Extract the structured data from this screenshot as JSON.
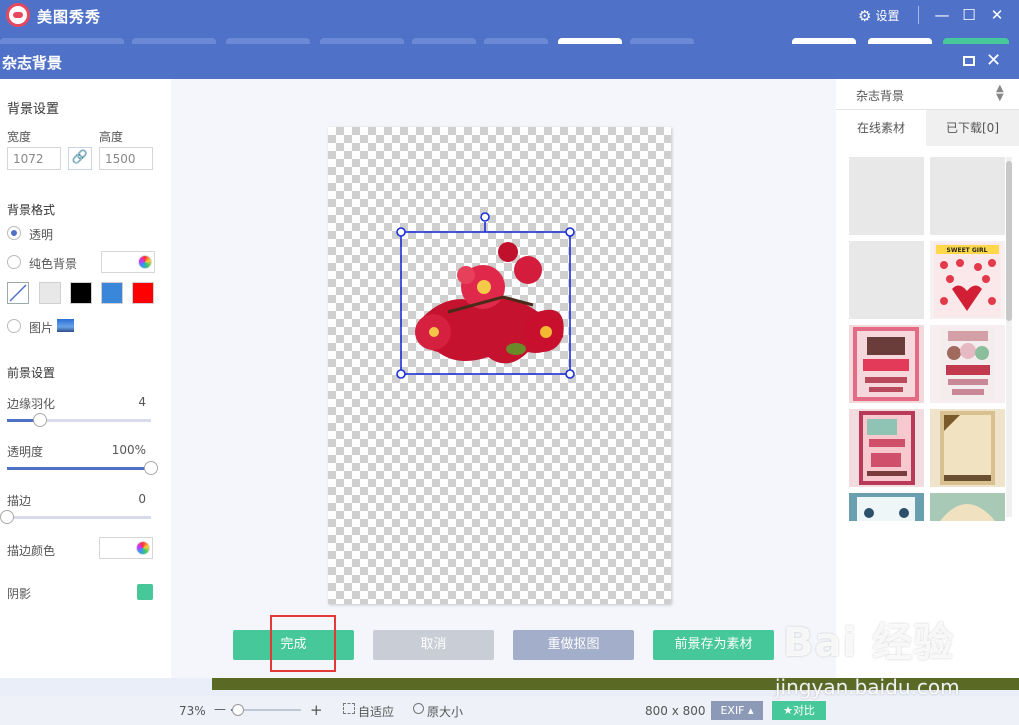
{
  "app": {
    "title": "美图秀秀",
    "settings_label": "设置",
    "minimize_glyph": "—",
    "maximize_glyph": "☐",
    "close_glyph": "✕",
    "gear_glyph": "⚙"
  },
  "dialog": {
    "title": "杂志背景",
    "close_glyph": "✕"
  },
  "left": {
    "bg_settings": "背景设置",
    "width_label": "宽度",
    "height_label": "高度",
    "width_value": "1072",
    "height_value": "1500",
    "link_glyph": "🔗",
    "bg_format": "背景格式",
    "opt_transparent": "透明",
    "opt_solid": "纯色背景",
    "opt_image": "图片",
    "swatch_colors": [
      "#e8e8e8",
      "#000000",
      "#3a86d9",
      "#ff0000"
    ],
    "fg_settings": "前景设置",
    "feather_label": "边缘羽化",
    "feather_value": "4",
    "feather_level": 0.23,
    "opacity_label": "透明度",
    "opacity_value": "100%",
    "opacity_level": 1.0,
    "stroke_label": "描边",
    "stroke_value": "0",
    "stroke_level": 0.0,
    "stroke_color_label": "描边颜色",
    "shadow_label": "阴影"
  },
  "actions": {
    "done": "完成",
    "cancel": "取消",
    "redo_cutout": "重做抠图",
    "save_fg": "前景存为素材"
  },
  "right": {
    "category": "杂志背景",
    "tab_online": "在线素材",
    "tab_downloaded": "已下载[0]",
    "sweet_girl": "SWEET GIRL"
  },
  "status": {
    "zoom": "73%",
    "zoom_minus": "—",
    "zoom_plus": "+",
    "zoom_level": 0.1,
    "fit_label": "自适应",
    "actual_label": "原大小",
    "dimensions": "800 x 800",
    "exif": "EXIF ▴",
    "compare": "对比"
  },
  "watermark": {
    "brand": "Bai 经验",
    "url": "jingyan.baidu.com"
  },
  "colors": {
    "header_blue": "#4f72c8",
    "accent_green": "#46c89a",
    "disabled_gray": "#c9cdd6",
    "redo_gray": "#a3aeca",
    "selection_blue": "#1a2fd6",
    "highlight_red": "#e53935"
  }
}
